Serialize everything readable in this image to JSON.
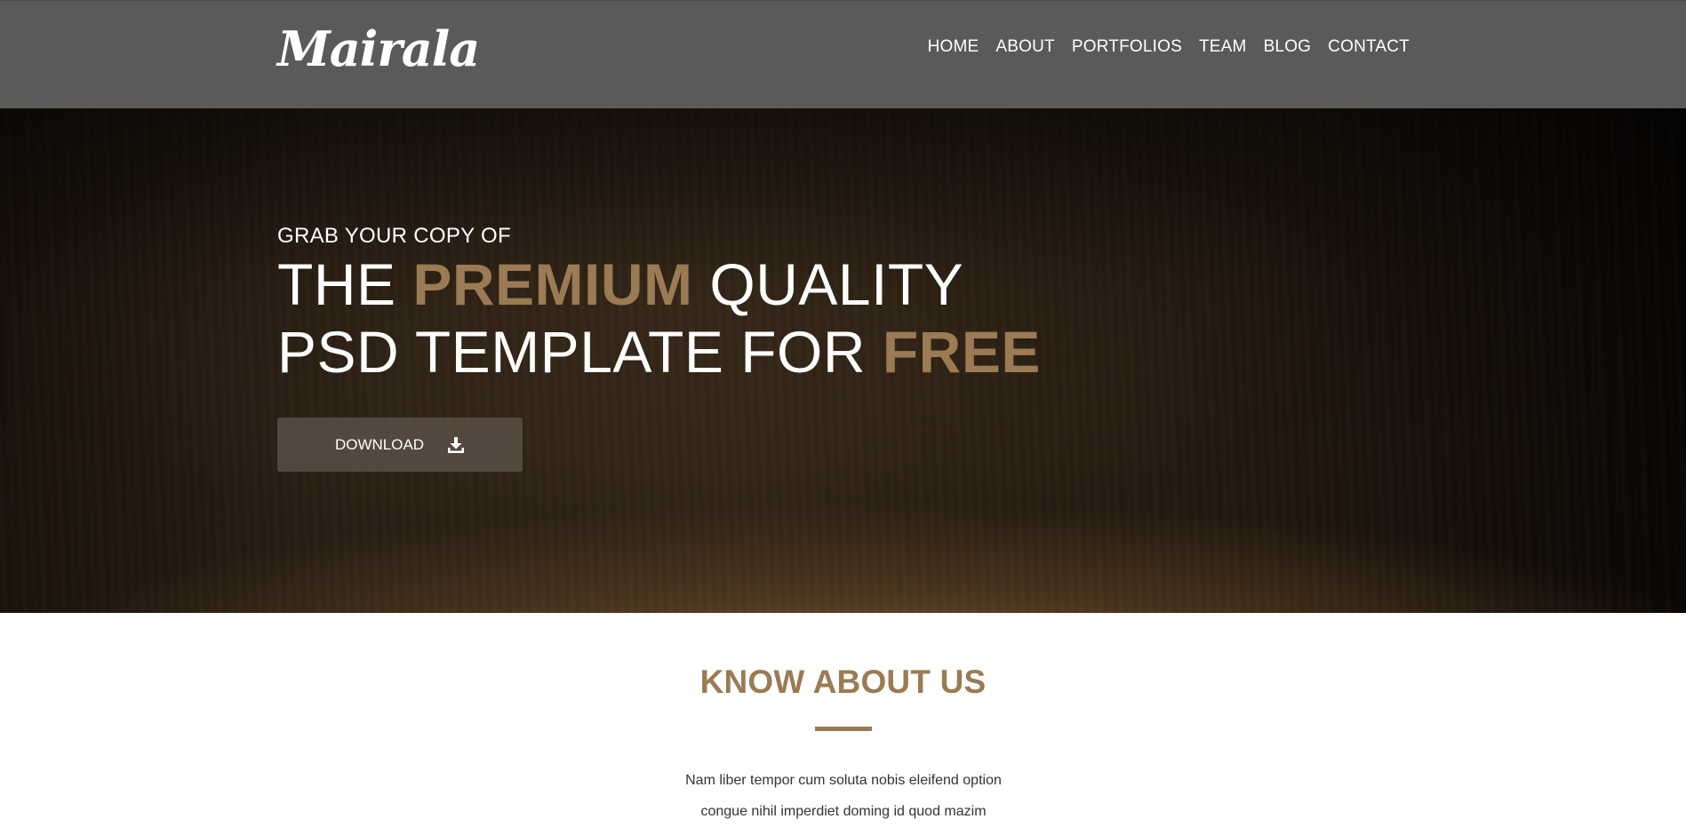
{
  "header": {
    "logo": "Mairala",
    "nav": [
      "HOME",
      "ABOUT",
      "PORTFOLIOS",
      "TEAM",
      "BLOG",
      "CONTACT"
    ]
  },
  "hero": {
    "kicker": "GRAB YOUR COPY OF",
    "line1_pre": "THE ",
    "line1_accent": "PREMIUM",
    "line1_post": " QUALITY",
    "line2_pre": "PSD TEMPLATE FOR ",
    "line2_accent": "FREE",
    "download_label": "DOWNLOAD",
    "download_icon": "download-icon"
  },
  "about": {
    "title": "KNOW ABOUT US",
    "text_line1": "Nam liber tempor cum soluta nobis eleifend option",
    "text_line2": "congue nihil imperdiet doming id quod mazim"
  },
  "colors": {
    "navbar": "#5a5a5a",
    "accent": "#9a7b53",
    "button": "#584c42",
    "text_dark": "#333333"
  }
}
